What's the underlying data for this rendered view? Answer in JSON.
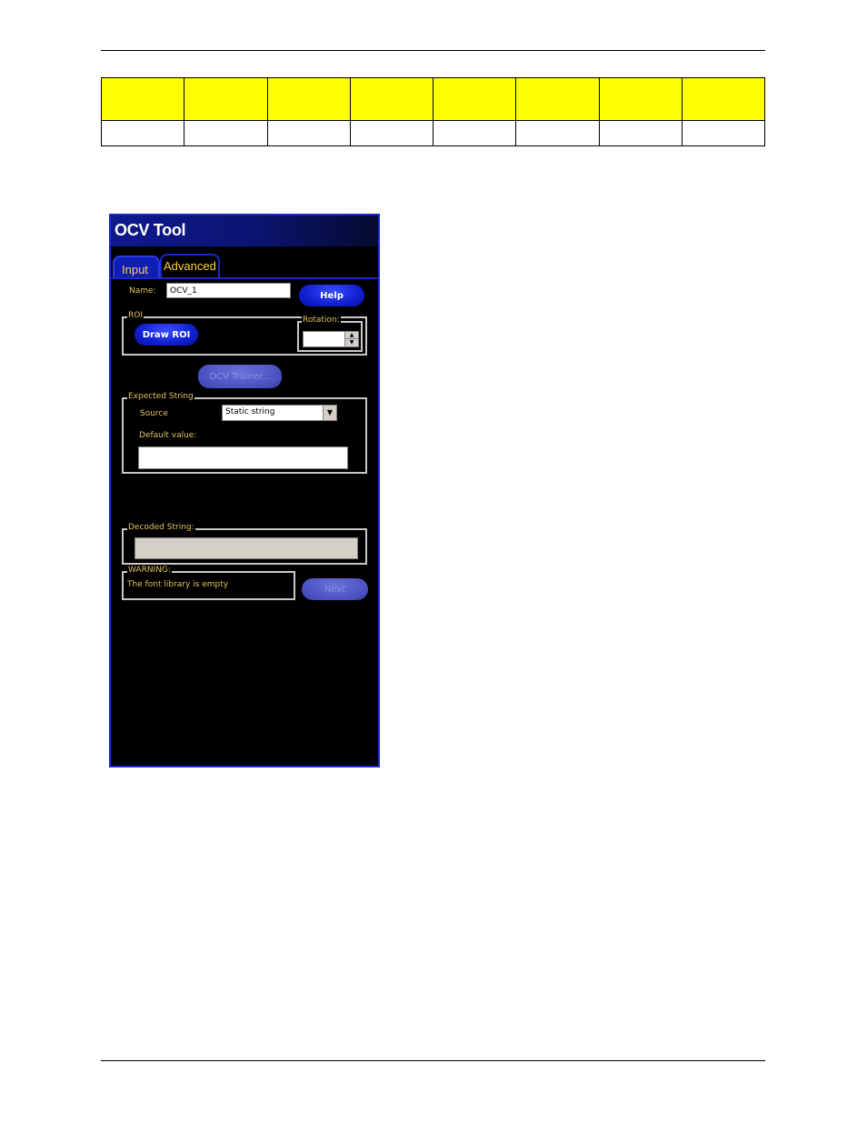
{
  "window": {
    "title": "OCV Tool",
    "tabs": [
      {
        "label": "Input",
        "active": true
      },
      {
        "label": "Advanced",
        "active": false
      }
    ]
  },
  "form": {
    "name_label": "Name:",
    "name_value": "OCV_1",
    "help_label": "Help",
    "roi_group_label": "ROI",
    "draw_roi_label": "Draw ROI",
    "rotation_label": "Rotation:",
    "rotation_value": "",
    "trainer_label": "OCV Trainer...",
    "expected_group_label": "Expected String",
    "source_label": "Source",
    "source_selected": "Static string",
    "default_value_label": "Default value:",
    "default_value": "",
    "decoded_group_label": "Decoded String:",
    "decoded_value": "",
    "warning_group_label": "WARNING:",
    "warning_text": "The font library is empty",
    "next_label": "Next"
  },
  "colors": {
    "header_cells": "#ffff00",
    "window_frame": "#1a28c8",
    "label_text": "#e0c45a"
  }
}
